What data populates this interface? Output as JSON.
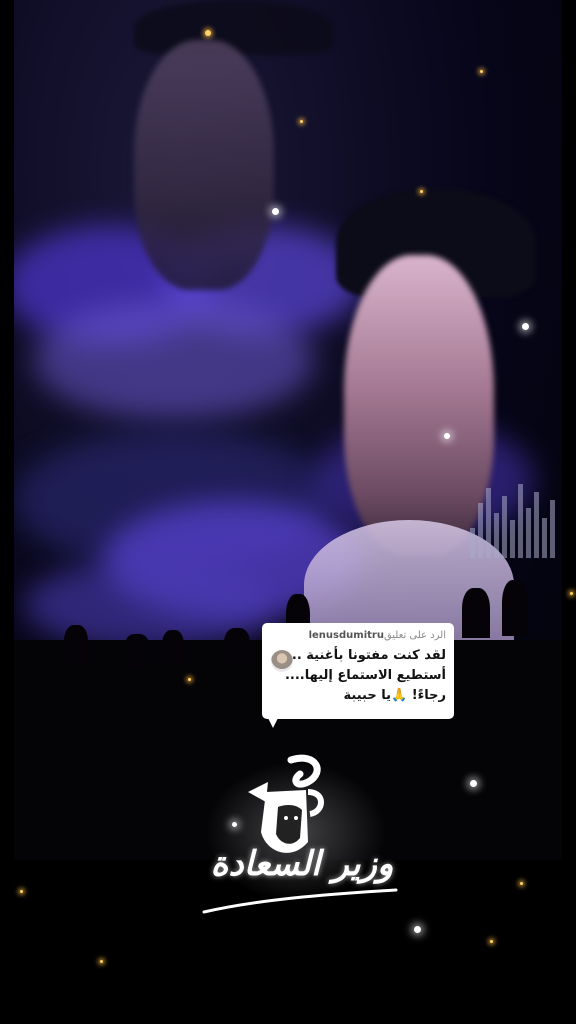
{
  "comment_reply": {
    "prefix": "الرد على تعليق",
    "username": "lenusdumitru",
    "lines": [
      "لقد كنت مفتونا بأغنية ...",
      "أستطيع الاستماع إليها....",
      "رجاءً! 🙏يا حبيبة"
    ]
  },
  "logo": {
    "text": "وزير السعادة",
    "letter": "ع"
  },
  "colors": {
    "background": "#000000",
    "cloud_purple": "#5b3fd6",
    "comment_bg": "#ffffff",
    "spark": "#ffd36a"
  }
}
